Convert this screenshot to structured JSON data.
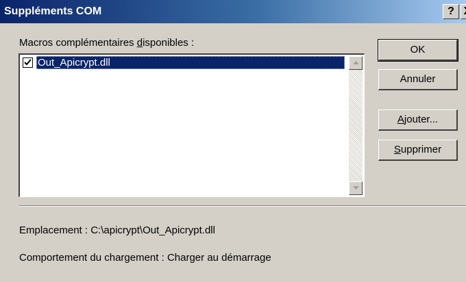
{
  "window": {
    "title": "Suppléments COM",
    "help_label": "?",
    "close_label": "X"
  },
  "available_label": {
    "before": "Macros complémentaires ",
    "accel": "d",
    "after": "isponibles :"
  },
  "addins": [
    {
      "name": "Out_Apicrypt.dll",
      "checked": true,
      "selected": true
    }
  ],
  "buttons": {
    "ok": {
      "label": "OK"
    },
    "cancel": {
      "label": "Annuler"
    },
    "add": {
      "accel": "A",
      "rest": "jouter..."
    },
    "remove": {
      "accel": "S",
      "rest": "upprimer"
    }
  },
  "details": {
    "location_label": "Emplacement :",
    "location_value": "C:\\apicrypt\\Out_Apicrypt.dll",
    "load_behavior_label": "Comportement du chargement :",
    "load_behavior_value": "Charger au démarrage"
  }
}
